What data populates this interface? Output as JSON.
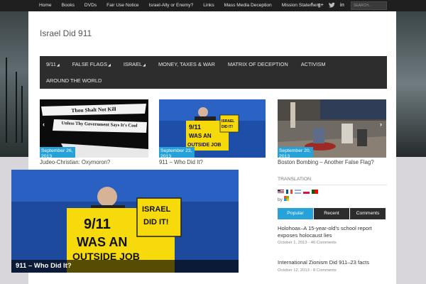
{
  "topnav": [
    "Home",
    "Books",
    "DVDs",
    "Fair Use Notice",
    "Israel-Ally or Enemy?",
    "Links",
    "Mass Media Deception",
    "Mission Statement"
  ],
  "search_placeholder": "SEARCH...",
  "site_title": "Israel Did 911",
  "mainnav": {
    "row1": [
      {
        "label": "9/11",
        "caret": "◢"
      },
      {
        "label": "FALSE FLAGS",
        "caret": "◢"
      },
      {
        "label": "ISRAEL",
        "caret": "◢"
      },
      {
        "label": "MONEY, TAXES & WAR",
        "caret": ""
      },
      {
        "label": "MATRIX OF DECEPTION",
        "caret": ""
      },
      {
        "label": "ACTIVISM",
        "caret": ""
      }
    ],
    "row2": [
      {
        "label": "AROUND THE WORLD",
        "caret": ""
      }
    ]
  },
  "slider": [
    {
      "date": "September 26, 2013",
      "title": "Judeo-Christian: Oxymoron?",
      "banner_line1": "Thou Shalt Not Kill",
      "banner_line2": "Unless Thy Government Says It's Cool"
    },
    {
      "date": "September 23, 2013",
      "title": "911 – Who Did It?",
      "sign_main": "9/11 WAS AN OUTSIDE JOB",
      "sign_small": "ISRAEL DID IT!"
    },
    {
      "date": "September 20, 2013",
      "title": "Boston Bombing – Another False Flag?"
    }
  ],
  "feature": {
    "title": "911 – Who Did It?",
    "sign_main_l1": "9/11",
    "sign_main_l2": "WAS AN",
    "sign_main_l3": "OUTSIDE JOB",
    "sign_small_l1": "ISRAEL",
    "sign_small_l2": "DID IT!"
  },
  "sidebar": {
    "translation_heading": "TRANSLATION",
    "by_label": "by",
    "tabs": [
      "Popular",
      "Recent",
      "Comments"
    ],
    "posts": [
      {
        "title": "Holohoax–A 15-year-old's school report exposes holocaust lies",
        "meta": "October 1, 2013 - 46 Comments"
      },
      {
        "title": "International Zionism Did 911–23 facts",
        "meta": "October 12, 2013 - 8 Comments"
      }
    ]
  },
  "colors": {
    "accent": "#27a2d8",
    "nav_bg": "#2d2d2d",
    "topbar_bg": "#1f1f1f"
  },
  "icons": [
    "facebook-icon",
    "google-plus-icon",
    "twitter-icon",
    "linkedin-icon"
  ]
}
